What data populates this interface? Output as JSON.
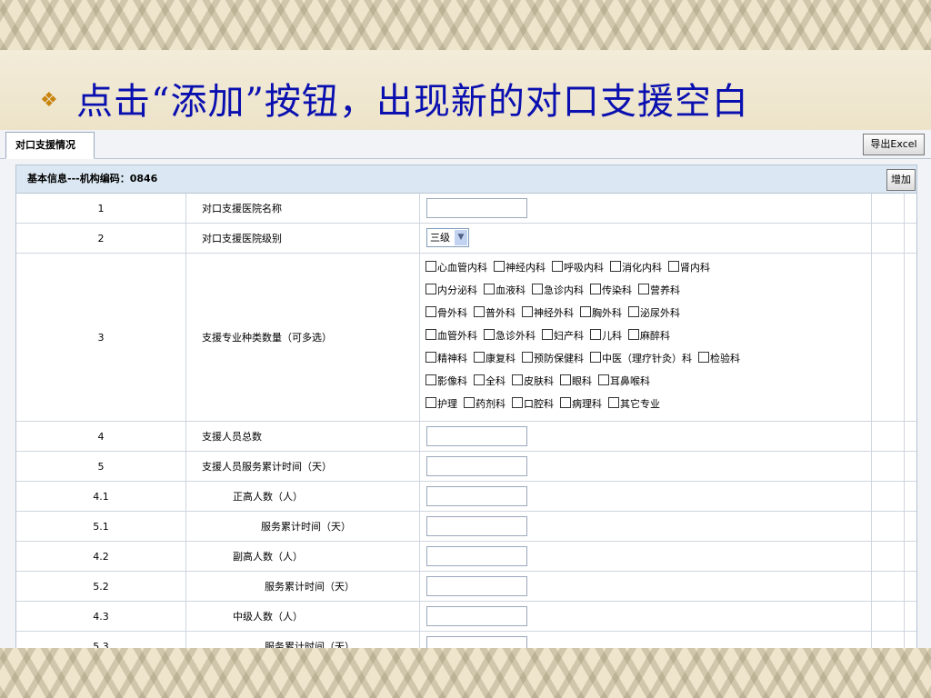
{
  "slide": {
    "title": "点击“添加”按钮，出现新的对口支援空白"
  },
  "tab": {
    "label": "对口支援情况"
  },
  "toolbar": {
    "export_label": "导出Excel"
  },
  "section": {
    "header": "基本信息---机构编码：0846",
    "add_label": "增加"
  },
  "rows": [
    {
      "num": "1",
      "label": "对口支援医院名称"
    },
    {
      "num": "2",
      "label": "对口支援医院级别",
      "select_value": "三级"
    },
    {
      "num": "3",
      "label": "支援专业种类数量（可多选）"
    },
    {
      "num": "4",
      "label": "支援人员总数"
    },
    {
      "num": "5",
      "label": "支援人员服务累计时间（天）"
    },
    {
      "num": "4.1",
      "label": "正高人数（人）"
    },
    {
      "num": "5.1",
      "label": "服务累计时间（天）"
    },
    {
      "num": "4.2",
      "label": "副高人数（人）"
    },
    {
      "num": "5.2",
      "label": "服务累计时间（天）"
    },
    {
      "num": "4.3",
      "label": "中级人数（人）"
    },
    {
      "num": "5.3",
      "label": "服务累计时间（天）"
    }
  ],
  "specialties": [
    [
      "心血管内科",
      "神经内科",
      "呼吸内科",
      "消化内科",
      "肾内科"
    ],
    [
      "内分泌科",
      "血液科",
      "急诊内科",
      "传染科",
      "营养科"
    ],
    [
      "骨外科",
      "普外科",
      "神经外科",
      "胸外科",
      "泌尿外科"
    ],
    [
      "血管外科",
      "急诊外科",
      "妇产科",
      "儿科",
      "麻醉科"
    ],
    [
      "精神科",
      "康复科",
      "预防保健科",
      "中医（理疗针灸）科",
      "检验科"
    ],
    [
      "影像科",
      "全科",
      "皮肤科",
      "眼科",
      "耳鼻喉科"
    ],
    [
      "护理",
      "药剂科",
      "口腔科",
      "病理科",
      "其它专业"
    ]
  ],
  "icons": {
    "bullet": "diamond-bullet-icon",
    "dropdown": "chevron-down-icon"
  },
  "colors": {
    "title": "#0a0fb0",
    "bullet": "#c8840e",
    "section_header": "#dbe8f3"
  }
}
